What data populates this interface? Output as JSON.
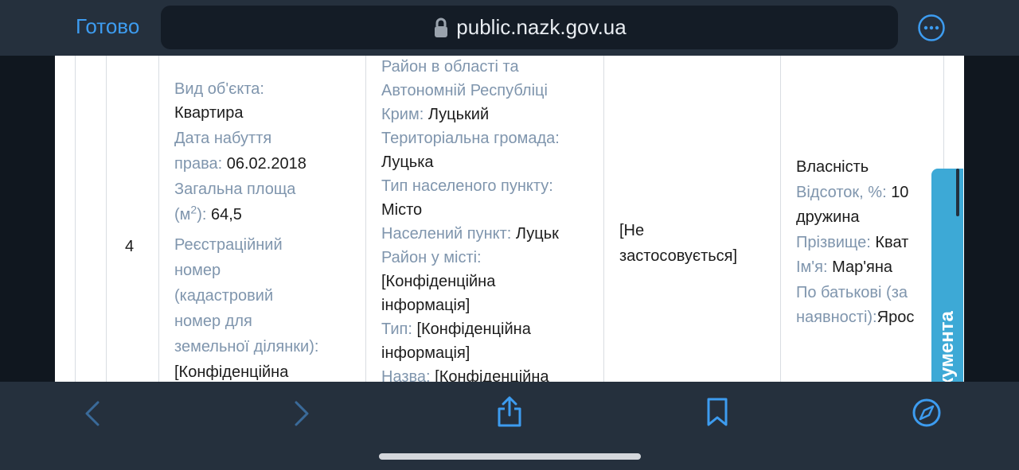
{
  "topbar": {
    "done_label": "Готово",
    "url": "public.nazk.gov.ua"
  },
  "table": {
    "row_number": "4",
    "object": {
      "type_label": "Вид об'єкта:",
      "type_value": "Квартира",
      "date_label_1": "Дата набуття",
      "date_label_2": "права:",
      "date_value": "06.02.2018",
      "area_label_1": "Загальна площа",
      "area_label_2a": "(м",
      "area_label_sup": "2",
      "area_label_2b": "):",
      "area_value": "64,5",
      "reg_label_1": "Реєстраційний",
      "reg_label_2": "номер",
      "reg_label_3": "(кадастровий",
      "reg_label_4": "номер для",
      "reg_label_5": "земельної ділянки):",
      "reg_value": "[Конфіденційна"
    },
    "location": {
      "district_label_1": "Район в області та",
      "district_label_2": "Автономній Республіці",
      "district_label_3": "Крим:",
      "district_value": "Луцький",
      "community_label": "Територіальна громада:",
      "community_value": "Луцька",
      "settlement_type_label": "Тип населеного пункту:",
      "settlement_type_value": "Місто",
      "settlement_label": "Населений пункт:",
      "settlement_value": "Луцьк",
      "city_district_label": "Район у місті:",
      "city_district_value_1": "[Конфіденційна",
      "city_district_value_2": "інформація]",
      "type_label": "Тип:",
      "type_value_1": "[Конфіденційна",
      "type_value_2": "інформація]",
      "name_label": "Назва:",
      "name_value": "[Конфіденційна"
    },
    "not_applicable_1": "[Не",
    "not_applicable_2": "застосовується]",
    "ownership": {
      "kind": "Власність",
      "percent_label": "Відсоток, %:",
      "percent_value": "10",
      "relation": "дружина",
      "surname_label": "Прізвище:",
      "surname_value": "Кват",
      "name_label": "Ім'я:",
      "name_value": "Мар'яна",
      "patronymic_label_1": "По батькові (за",
      "patronymic_label_2": "наявності):",
      "patronymic_value": "Ярос"
    }
  },
  "side_panel": {
    "label": "Зміст документа"
  },
  "colors": {
    "accent": "#3d9cf0",
    "label": "#7f95ad",
    "panel": "#3da9d6"
  }
}
